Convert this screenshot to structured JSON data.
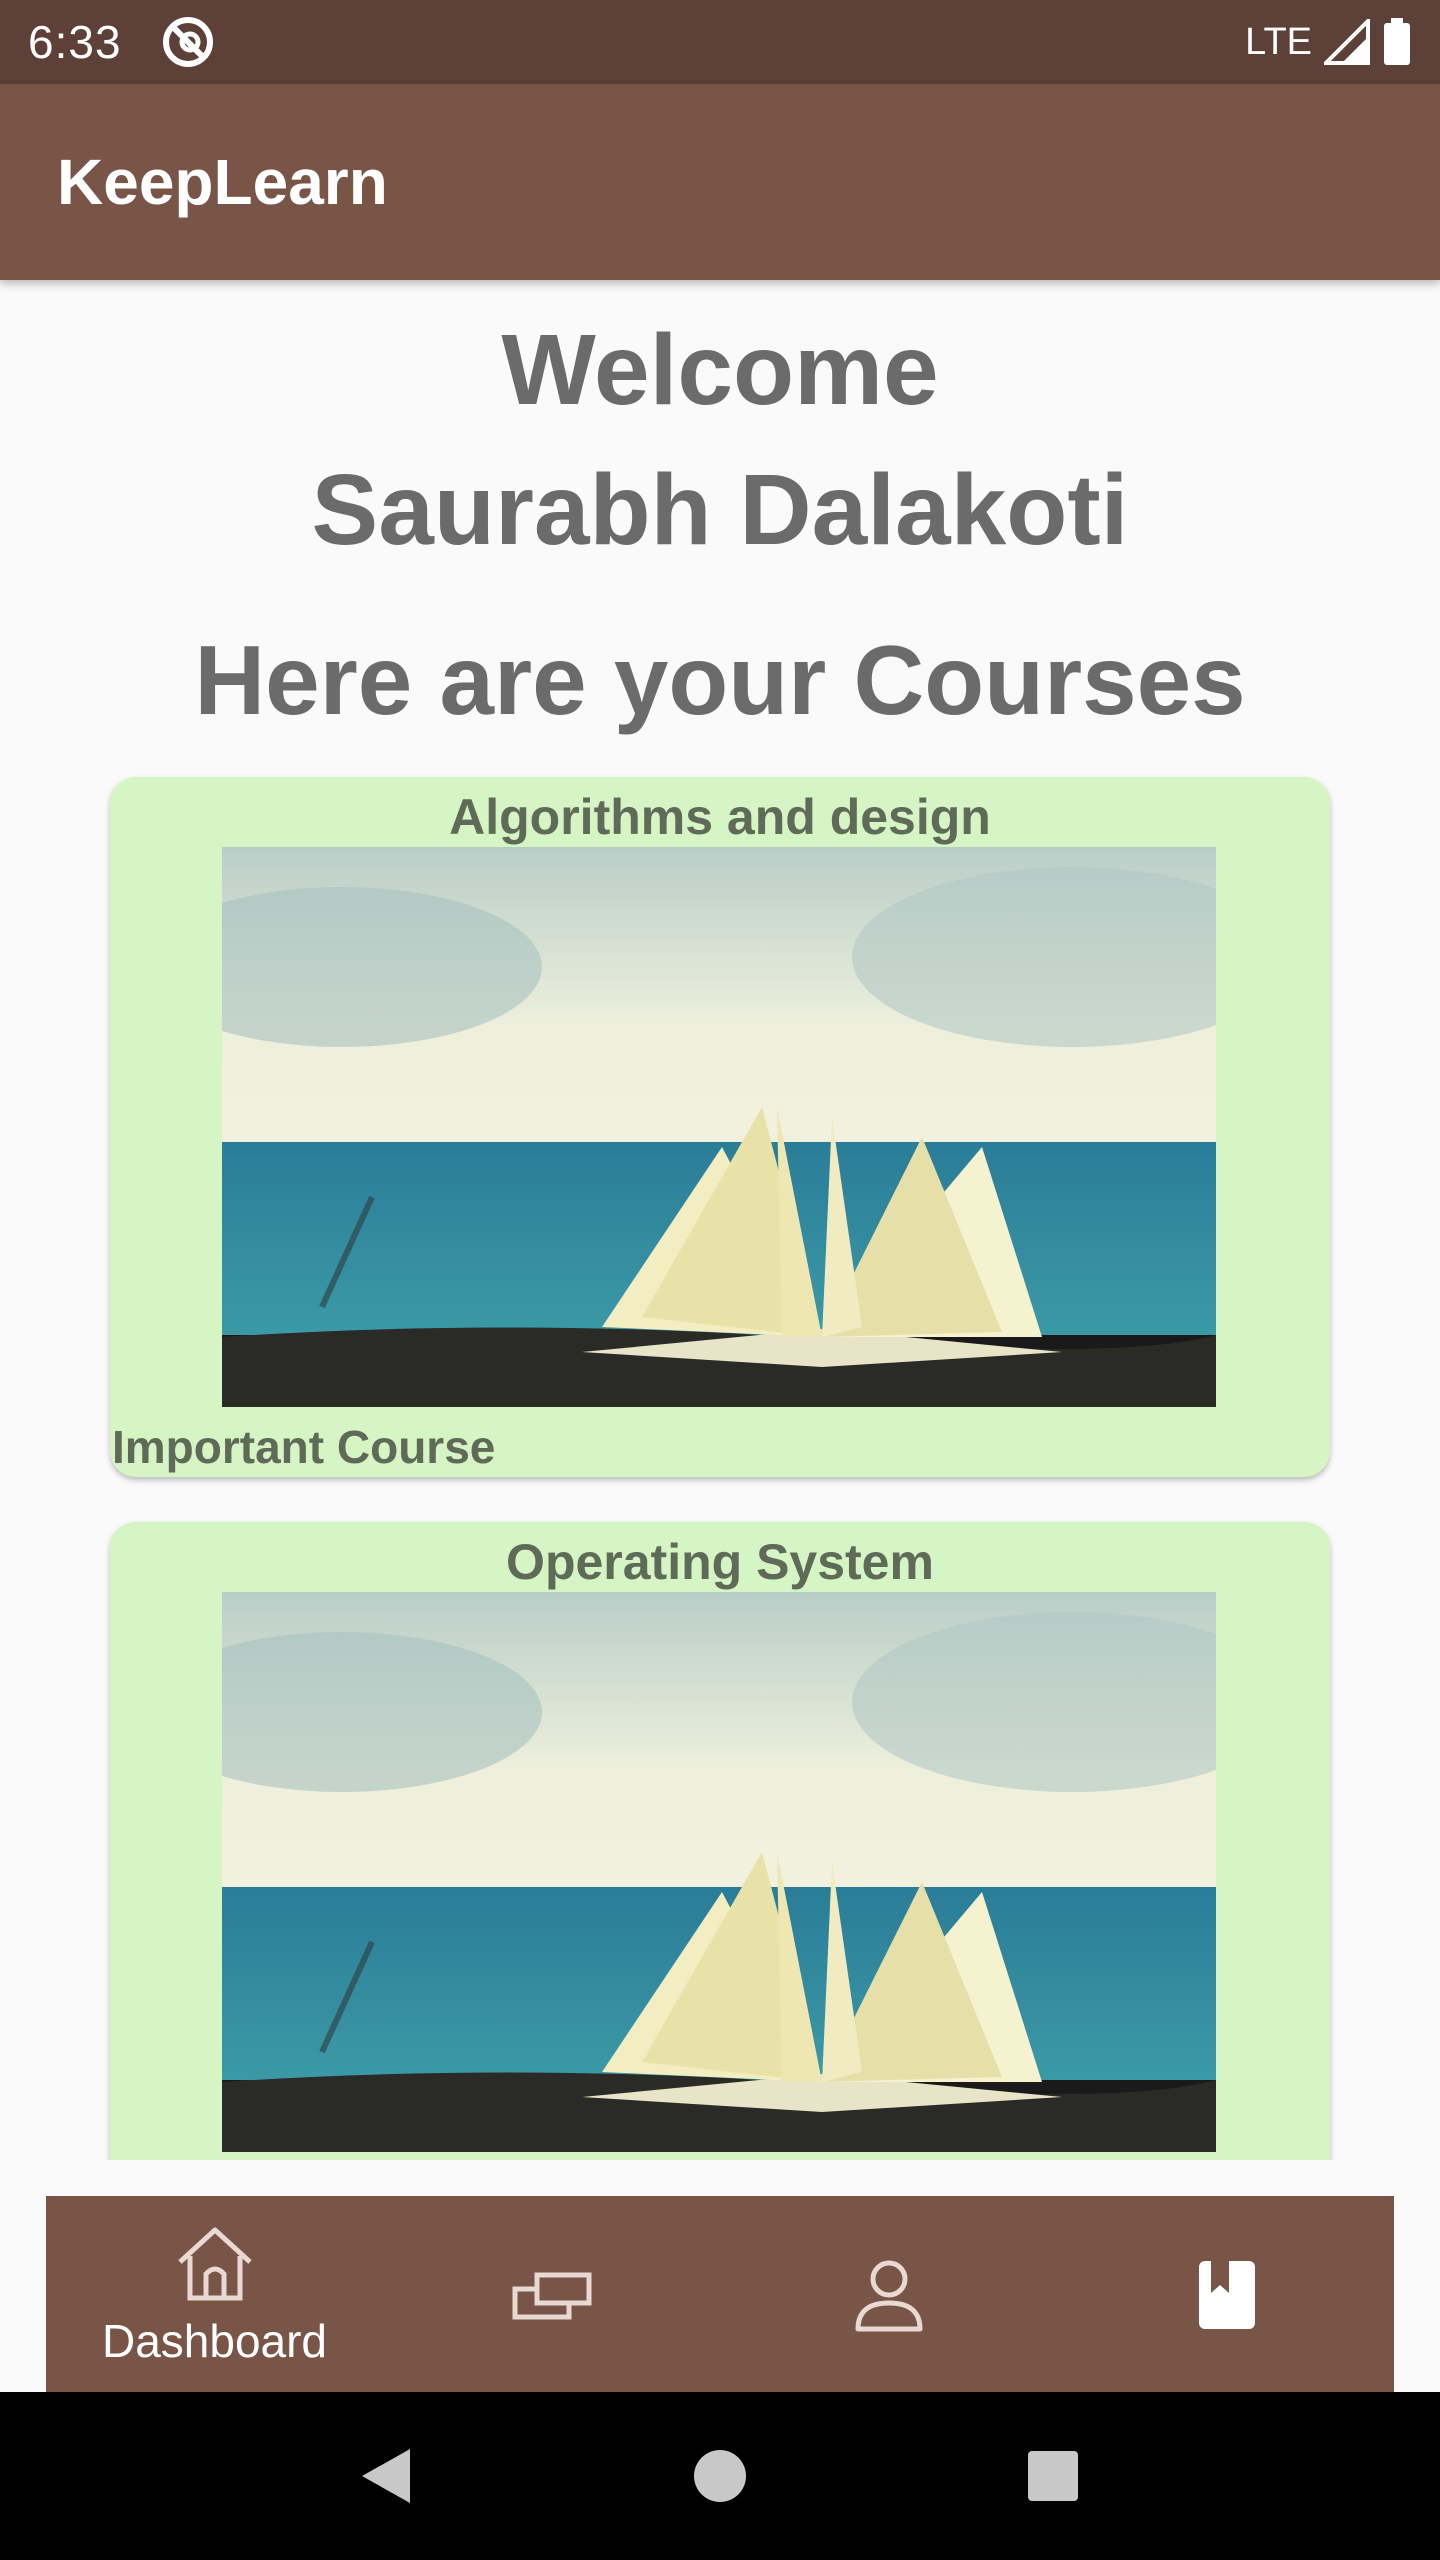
{
  "status_bar": {
    "time": "6:33",
    "network": "LTE",
    "icons": [
      "app-notification-icon",
      "signal-icon",
      "battery-icon"
    ]
  },
  "app_bar": {
    "title": "KeepLearn"
  },
  "welcome": {
    "greeting": "Welcome",
    "user_name": "Saurabh Dalakoti",
    "courses_heading": "Here are your Courses"
  },
  "courses": [
    {
      "title": "Algorithms and design",
      "tag": "Important Course",
      "image": "open-book-by-sea"
    },
    {
      "title": "Operating System",
      "tag": "",
      "image": "open-book-by-sea"
    }
  ],
  "bottom_nav": {
    "items": [
      {
        "label": "Dashboard",
        "icon": "home-icon"
      },
      {
        "label": "",
        "icon": "cards-icon"
      },
      {
        "label": "",
        "icon": "profile-icon"
      },
      {
        "label": "",
        "icon": "bookmark-book-icon"
      }
    ]
  },
  "system_nav": {
    "icons": [
      "back-icon",
      "home-circle-icon",
      "recents-icon"
    ]
  },
  "colors": {
    "status_bar": "#5d4037",
    "app_bar": "#795548",
    "card_bg": "#d5f5c4",
    "heading_text": "#6b6b6b",
    "card_text": "#5f6b58"
  }
}
